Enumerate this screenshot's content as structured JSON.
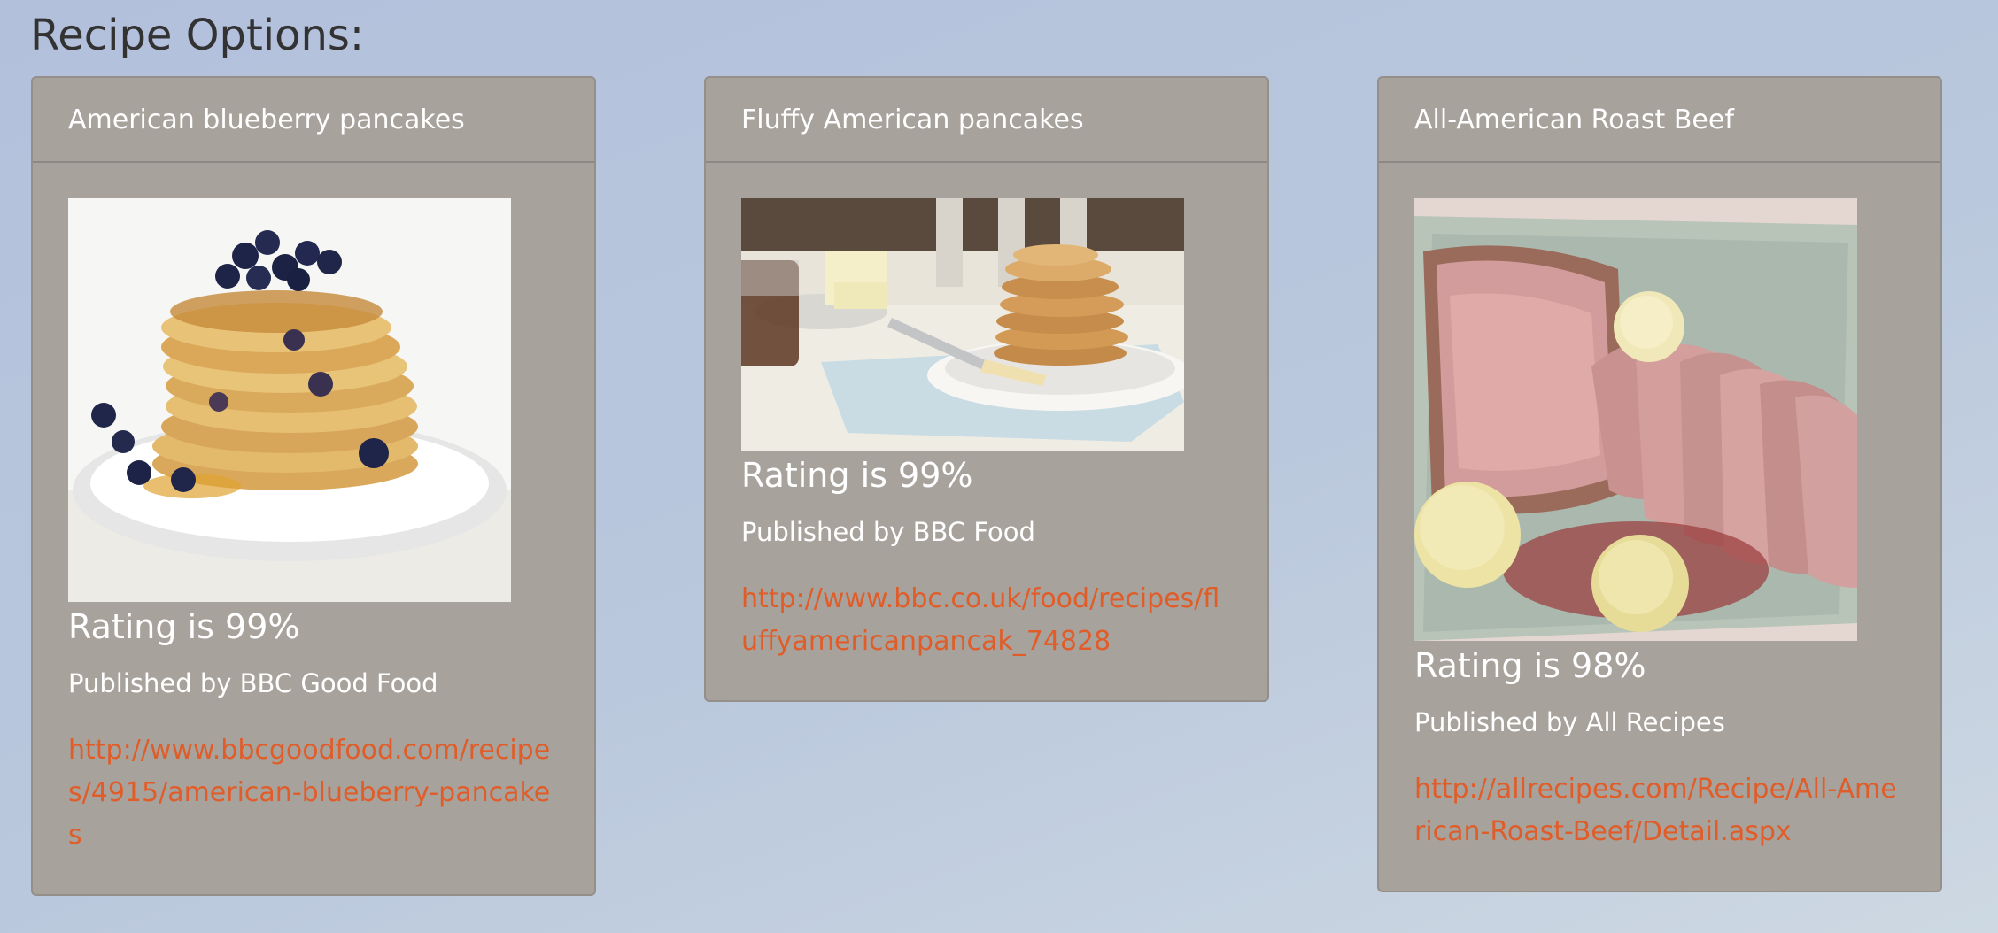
{
  "page": {
    "heading": "Recipe Options:"
  },
  "recipes": [
    {
      "title": "American blueberry pancakes",
      "rating": "Rating is 99%",
      "publisher": "Published by BBC Good Food",
      "url": "http://www.bbcgoodfood.com/recipes/4915/american-blueberry-pancakes",
      "image_icon": "blueberry-pancakes-photo"
    },
    {
      "title": "Fluffy American pancakes",
      "rating": "Rating is 99%",
      "publisher": "Published by BBC Food",
      "url": "http://www.bbc.co.uk/food/recipes/fluffyamericanpancak_74828",
      "image_icon": "fluffy-pancakes-photo"
    },
    {
      "title": "All-American Roast Beef",
      "rating": "Rating is 98%",
      "publisher": "Published by All Recipes",
      "url": "http://allrecipes.com/Recipe/All-American-Roast-Beef/Detail.aspx",
      "image_icon": "roast-beef-photo"
    }
  ],
  "colors": {
    "card_background": "#a8a29c",
    "link": "#e05d2a",
    "heading_text": "#333333"
  }
}
